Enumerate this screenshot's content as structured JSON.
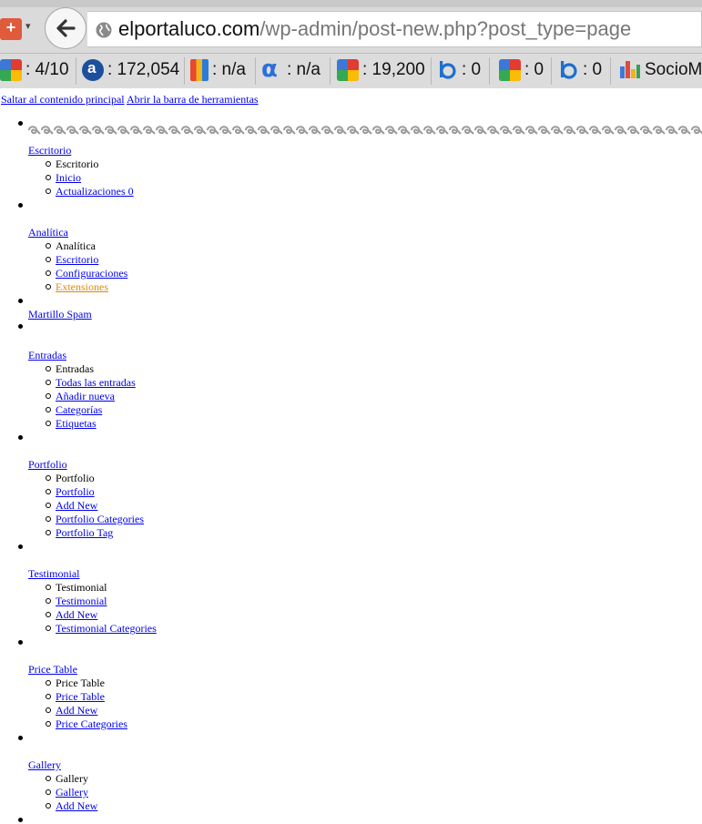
{
  "browser": {
    "url_host": "elportaluco.com",
    "url_path": "/wp-admin/post-new.php?post_type=page",
    "addon_glyph": "+",
    "addon_caret": "▾"
  },
  "toolbar": {
    "items": [
      {
        "icon": "google-pagerank-icon",
        "value": ": 4/10"
      },
      {
        "icon": "alexa-icon",
        "value": ": 172,054"
      },
      {
        "icon": "compete-icon",
        "value": ": n/a"
      },
      {
        "icon": "alpha-icon",
        "value": ": n/a"
      },
      {
        "icon": "google-icon",
        "value": ": 19,200"
      },
      {
        "icon": "bing-icon",
        "value": ": 0"
      },
      {
        "icon": "google-icon",
        "value": ": 0"
      },
      {
        "icon": "bing-icon",
        "value": ": 0"
      },
      {
        "icon": "sociometer-icon",
        "value": "SocioM"
      }
    ]
  },
  "skip_links": {
    "main": "Saltar al contenido principal",
    "toolbar": "Abrir la barra de herramientas"
  },
  "menu": {
    "escritorio": {
      "label": "Escritorio",
      "sub": [
        "Escritorio",
        "Inicio",
        "Actualizaciones 0"
      ]
    },
    "analitica": {
      "label": "Analítica",
      "sub": [
        "Analítica",
        "Escritorio",
        "Configuraciones",
        "Extensiones"
      ]
    },
    "spam": {
      "label": "Martillo Spam"
    },
    "entradas": {
      "label": "Entradas",
      "sub": [
        "Entradas",
        "Todas las entradas",
        "Añadir nueva",
        "Categorías",
        "Etiquetas"
      ]
    },
    "portfolio": {
      "label": "Portfolio",
      "sub": [
        "Portfolio",
        "Portfolio",
        "Add New",
        "Portfolio Categories",
        "Portfolio Tag"
      ]
    },
    "testimonial": {
      "label": "Testimonial",
      "sub": [
        "Testimonial",
        "Testimonial",
        "Add New",
        "Testimonial Categories"
      ]
    },
    "price_table": {
      "label": "Price Table",
      "sub": [
        "Price Table",
        "Price Table",
        "Add New",
        "Price Categories"
      ]
    },
    "gallery": {
      "label": "Gallery",
      "sub": [
        "Gallery",
        "Gallery",
        "Add New"
      ]
    }
  },
  "colors": {
    "link": "#0000ee",
    "current_link": "#d98a0e"
  }
}
